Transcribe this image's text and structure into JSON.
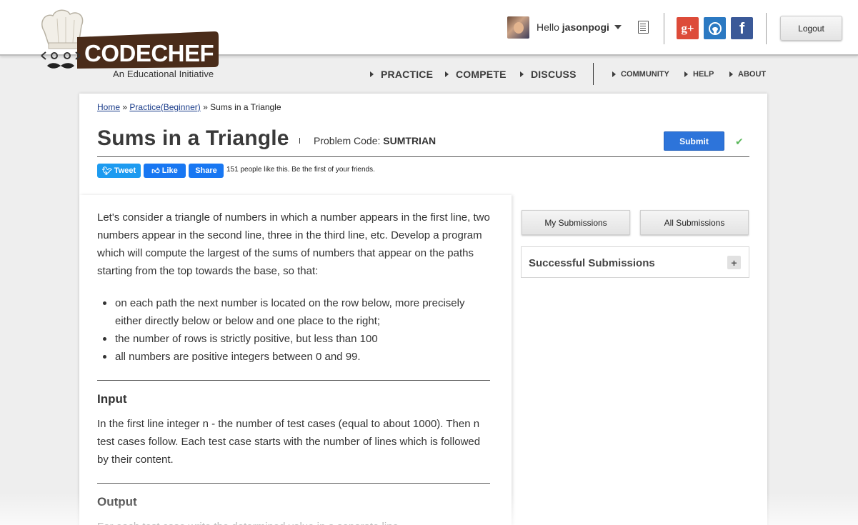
{
  "header": {
    "logo_text": "CODECHEF",
    "tagline": "An Educational Initiative",
    "greeting": "Hello",
    "username": "jasonpogi",
    "logout_label": "Logout",
    "social": {
      "gplus": "g+",
      "facebook": "f"
    }
  },
  "nav": {
    "main": [
      "PRACTICE",
      "COMPETE",
      "DISCUSS"
    ],
    "secondary": [
      "COMMUNITY",
      "HELP",
      "ABOUT"
    ]
  },
  "breadcrumb": {
    "home": "Home",
    "sep1": "»",
    "practice": "Practice(Beginner)",
    "sep2": "»",
    "current": "Sums in a Triangle"
  },
  "problem": {
    "title": "Sums in a Triangle",
    "code_label": "Problem Code:",
    "code": "SUMTRIAN",
    "submit_label": "Submit",
    "statement": "Let's consider a triangle of numbers in which a number appears in the first line, two numbers appear in the second line, three in the third line, etc. Develop a program which will compute the largest of the sums of numbers that appear on the paths starting from the top towards the base, so that:",
    "bullets": [
      "on each path the next number is located on the row below, more precisely either directly below or below and one place to the right;",
      "the number of rows is strictly positive, but less than 100",
      "all numbers are positive integers between 0 and 99."
    ],
    "input_heading": "Input",
    "input_text": "In the first line integer n - the number of test cases (equal to about 1000). Then n test cases follow. Each test case starts with the number of lines which is followed by their content.",
    "output_heading": "Output",
    "output_text": "For each test case write the determined value in a separate line."
  },
  "social_bar": {
    "tweet": "Tweet",
    "like": "Like",
    "share": "Share",
    "likes_text": "151 people like this. Be the first of your friends."
  },
  "sidebar": {
    "my_submissions": "My Submissions",
    "all_submissions": "All Submissions",
    "successful_title": "Successful Submissions",
    "expand": "+"
  },
  "colors": {
    "brand_brown": "#4a2c1a",
    "submit_blue": "#2d74da",
    "check_green": "#5cb85c"
  }
}
